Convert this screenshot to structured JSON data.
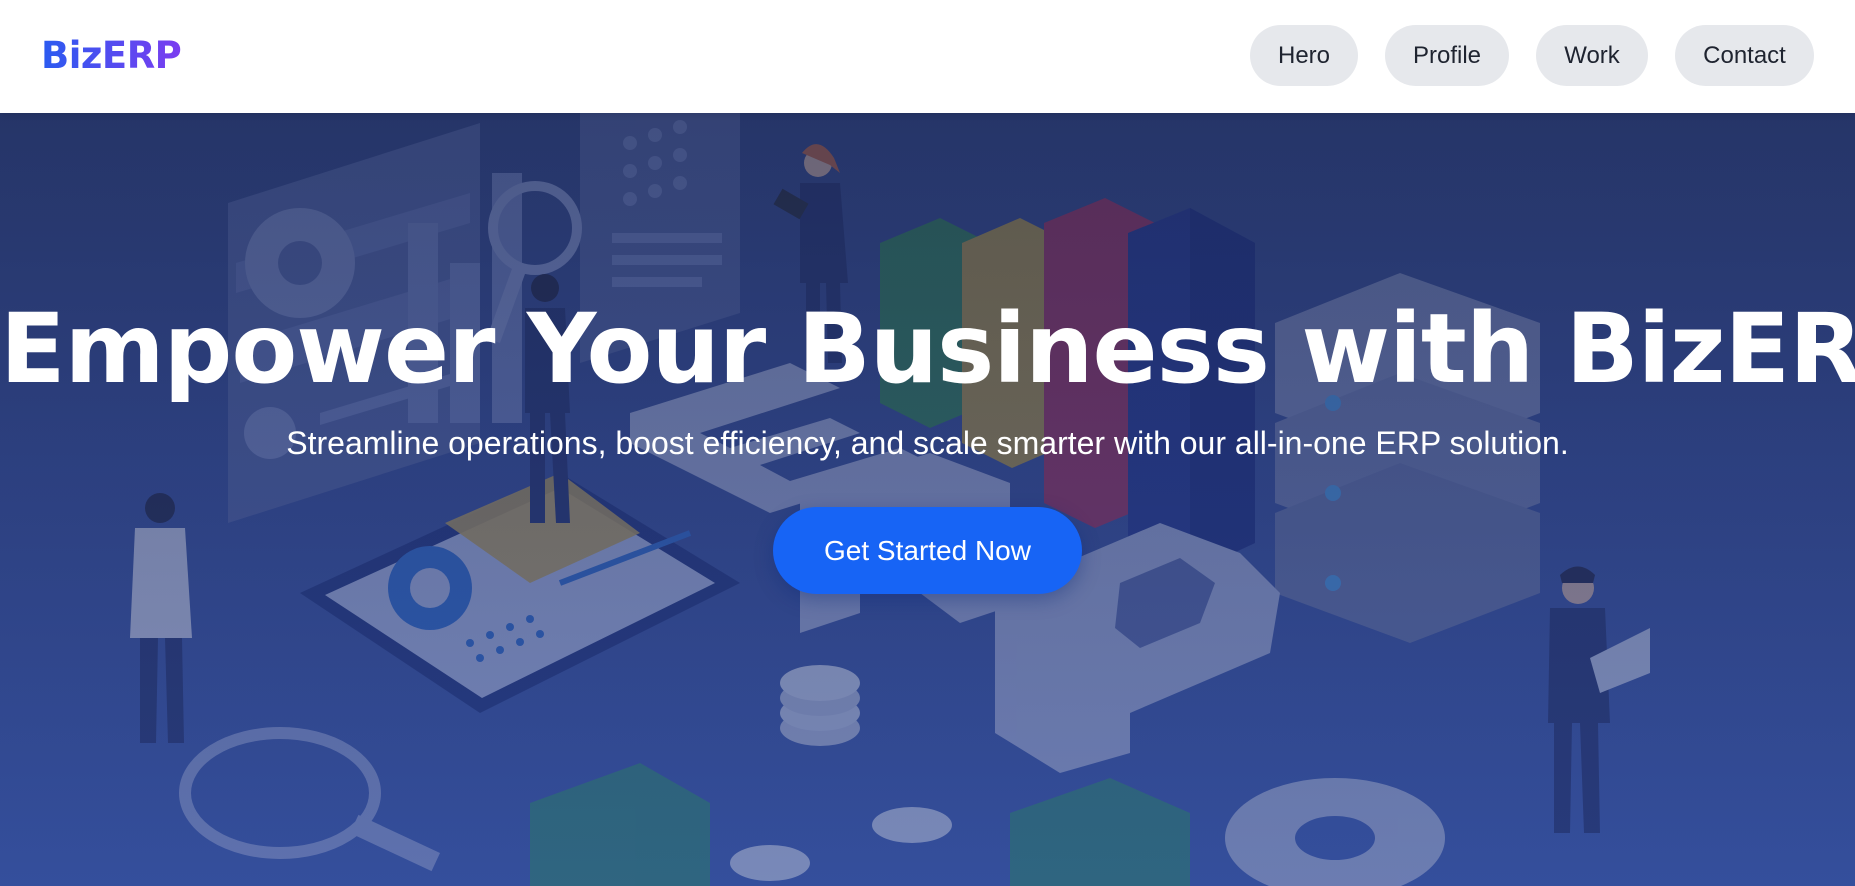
{
  "brand": {
    "logo_text": "BizERP"
  },
  "nav": {
    "items": [
      {
        "label": "Hero"
      },
      {
        "label": "Profile"
      },
      {
        "label": "Work"
      },
      {
        "label": "Contact"
      }
    ]
  },
  "hero": {
    "title": "Empower Your Business with BizERP",
    "subtitle": "Streamline operations, boost efficiency, and scale smarter with our all-in-one ERP solution.",
    "cta_label": "Get Started Now",
    "illustration_letters": [
      "E",
      "R",
      "P"
    ]
  },
  "colors": {
    "brand_gradient_start": "#2a5bf0",
    "brand_gradient_end": "#7b3df0",
    "cta": "#1764f5",
    "nav_pill": "#e6e8ec",
    "hero_bg": "#34498f"
  }
}
